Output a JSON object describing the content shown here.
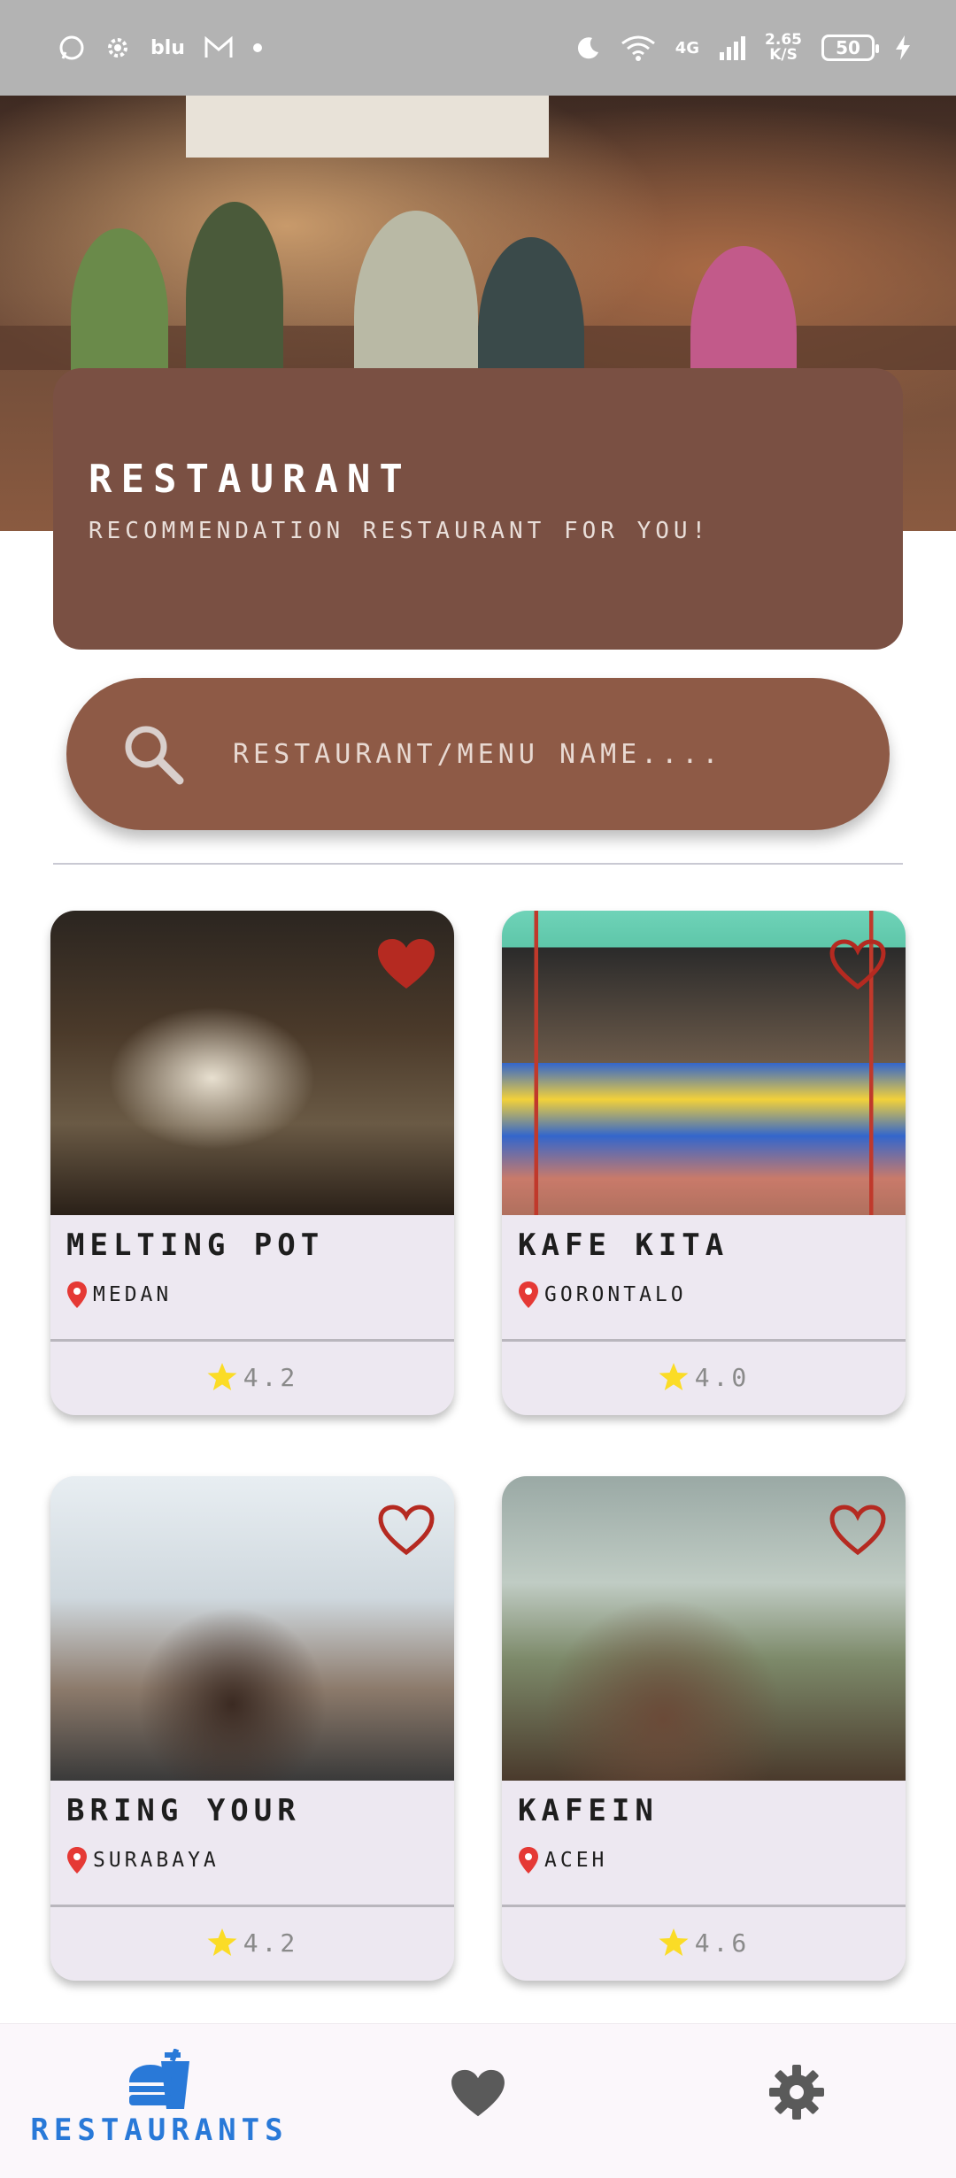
{
  "status_bar": {
    "network": "4G",
    "speed_value": "2.65",
    "speed_unit": "K/S",
    "battery": "50",
    "app_text": "blu"
  },
  "header": {
    "title": "RESTAURANT",
    "subtitle": "RECOMMENDATION RESTAURANT FOR YOU!"
  },
  "search": {
    "placeholder": "RESTAURANT/MENU NAME...."
  },
  "restaurants": [
    {
      "name": "MELTING POT",
      "city": "MEDAN",
      "rating": "4.2",
      "favorite": true
    },
    {
      "name": "KAFE KITA",
      "city": "GORONTALO",
      "rating": "4.0",
      "favorite": false
    },
    {
      "name": "BRING YOUR",
      "city": "SURABAYA",
      "rating": "4.2",
      "favorite": false
    },
    {
      "name": "KAFEIN",
      "city": "ACEH",
      "rating": "4.6",
      "favorite": false
    }
  ],
  "bottom_nav": {
    "items": [
      {
        "label": "RESTAURANTS",
        "icon": "burger-drink-icon",
        "active": true
      },
      {
        "label": "",
        "icon": "heart-icon",
        "active": false
      },
      {
        "label": "",
        "icon": "gear-icon",
        "active": false
      }
    ]
  },
  "colors": {
    "card_brown": "#7a5043",
    "search_brown": "#8e5a46",
    "heart_red": "#b52a21",
    "star_yellow": "#fbdc26",
    "accent_blue": "#2979d8",
    "card_bg": "#ede8f1"
  }
}
